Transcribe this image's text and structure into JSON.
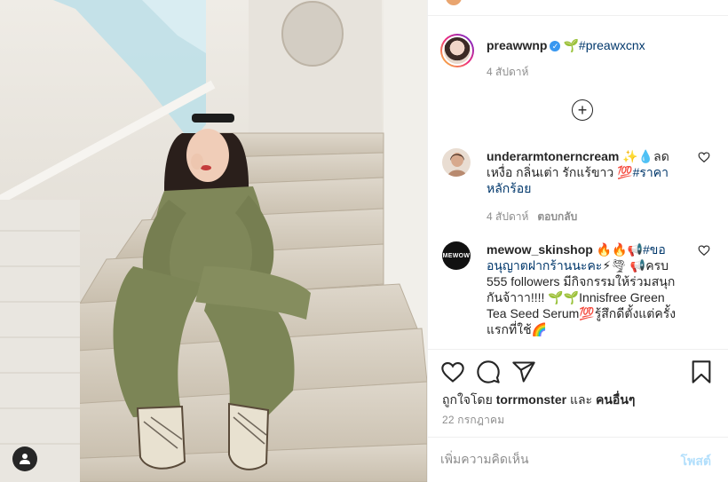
{
  "post": {
    "author": "preawwnp",
    "verified_glyph": "✓",
    "caption_emoji": "🌱",
    "caption_hashtag": "#preawxcnx",
    "date": "4 สัปดาห์"
  },
  "more_comments_glyph": "+",
  "comments": [
    {
      "user": "underarmtonerncream",
      "text_before": " ✨💧ลดเหงื่อ กลิ่นเต่า รักแร้ขาว 💯",
      "hashtag": "#ราคาหลักร้อย",
      "text_after": "",
      "time": "4 สัปดาห์",
      "reply_label": "ตอบกลับ"
    },
    {
      "user": "mewow_skinshop",
      "avatar_text": "MEWOW",
      "text_before": " 🔥🔥📢",
      "hashtag": "#ขออนุญาตฝากร้านนะคะ",
      "text_after": "⚡🌪 📢ครบ 555 followers มีกิจกรรมให้ร่วมสนุกกันจ้าาา!!!! 🌱🌱Innisfree Green Tea Seed Serum💯รู้สึกดีตั้งแต่ครั้งแรกที่ใช้🌈"
    }
  ],
  "actions": {
    "liked_by_prefix": "ถูกใจโดย ",
    "liked_by_user": "torrmonster",
    "liked_by_join": " และ ",
    "liked_by_others": "คนอื่นๆ",
    "post_date": "22 กรกฎาคม"
  },
  "comment_form": {
    "placeholder": "เพิ่มความคิดเห็น",
    "post_label": "โพสต์"
  },
  "icons": {
    "like": "heart-icon",
    "comment": "comment-icon",
    "share": "paper-plane-icon",
    "save": "bookmark-icon",
    "user_tags": "user-icon"
  },
  "colors": {
    "link": "#00376b",
    "post_button_disabled": "#b2dffc",
    "muted": "#8e8e8e",
    "verified": "#3897f0"
  }
}
